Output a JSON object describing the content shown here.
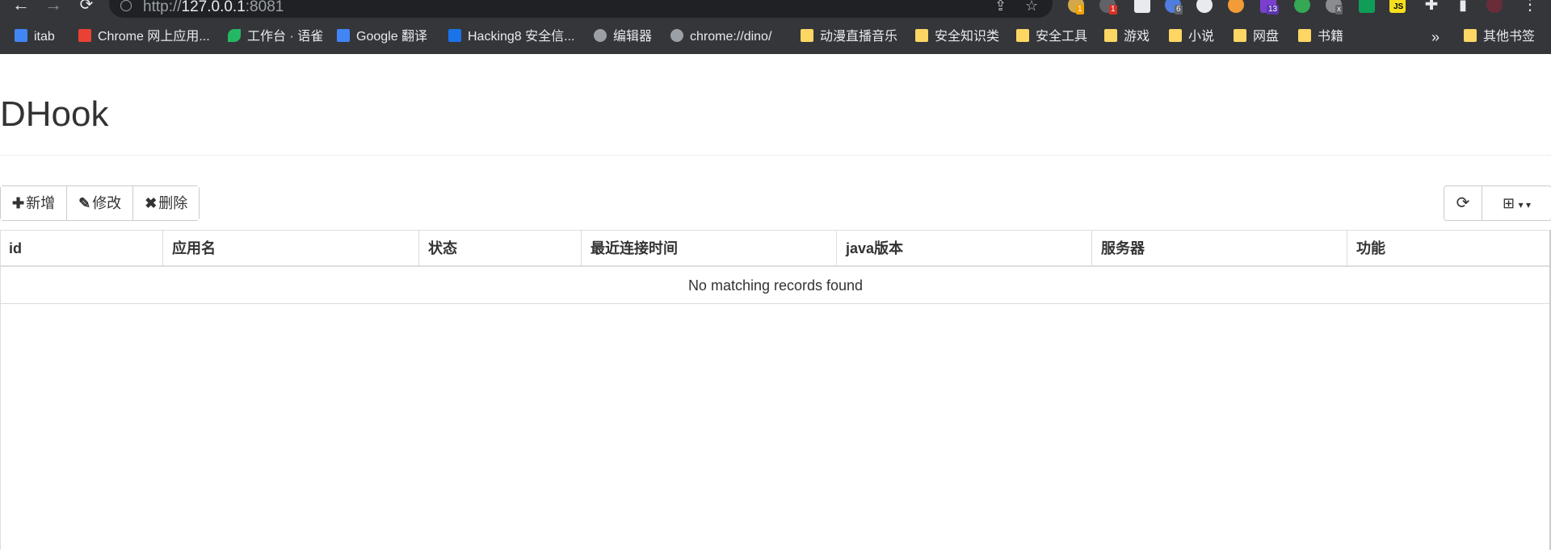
{
  "browser": {
    "url_prefix": "http://",
    "url_host": "127.0.0.1",
    "url_port": ":8081",
    "bookmarks": [
      {
        "label": "itab",
        "icon": "itab-icon",
        "color": "#4285f4"
      },
      {
        "label": "Chrome 网上应用...",
        "icon": "chrome-store-icon",
        "color": "#e94235"
      },
      {
        "label": "工作台 · 语雀",
        "icon": "yuque-icon",
        "color": "#25b864"
      },
      {
        "label": "Google 翻译",
        "icon": "google-translate-icon",
        "color": "#4285f4"
      },
      {
        "label": "Hacking8 安全信...",
        "icon": "hacking8-icon",
        "color": "#1a73e8"
      },
      {
        "label": "编辑器",
        "icon": "globe-icon",
        "color": "#9aa0a6"
      },
      {
        "label": "chrome://dino/",
        "icon": "globe-icon",
        "color": "#9aa0a6"
      },
      {
        "label": "动漫直播音乐",
        "icon": "folder-icon",
        "color": "#fdd663"
      },
      {
        "label": "安全知识类",
        "icon": "folder-icon",
        "color": "#fdd663"
      },
      {
        "label": "安全工具",
        "icon": "folder-icon",
        "color": "#fdd663"
      },
      {
        "label": "游戏",
        "icon": "folder-icon",
        "color": "#fdd663"
      },
      {
        "label": "小说",
        "icon": "folder-icon",
        "color": "#fdd663"
      },
      {
        "label": "网盘",
        "icon": "folder-icon",
        "color": "#fdd663"
      },
      {
        "label": "书籍",
        "icon": "folder-icon",
        "color": "#fdd663"
      }
    ],
    "overflow_label": "»",
    "other_bookmarks": "其他书签",
    "extension_badges": [
      "1",
      "1",
      "6",
      "13",
      "x",
      "JS"
    ]
  },
  "page": {
    "title": "DHook"
  },
  "toolbar": {
    "add_label": "新增",
    "edit_label": "修改",
    "delete_label": "删除"
  },
  "table": {
    "columns": [
      "id",
      "应用名",
      "状态",
      "最近连接时间",
      "java版本",
      "服务器",
      "功能"
    ],
    "empty_message": "No matching records found"
  }
}
